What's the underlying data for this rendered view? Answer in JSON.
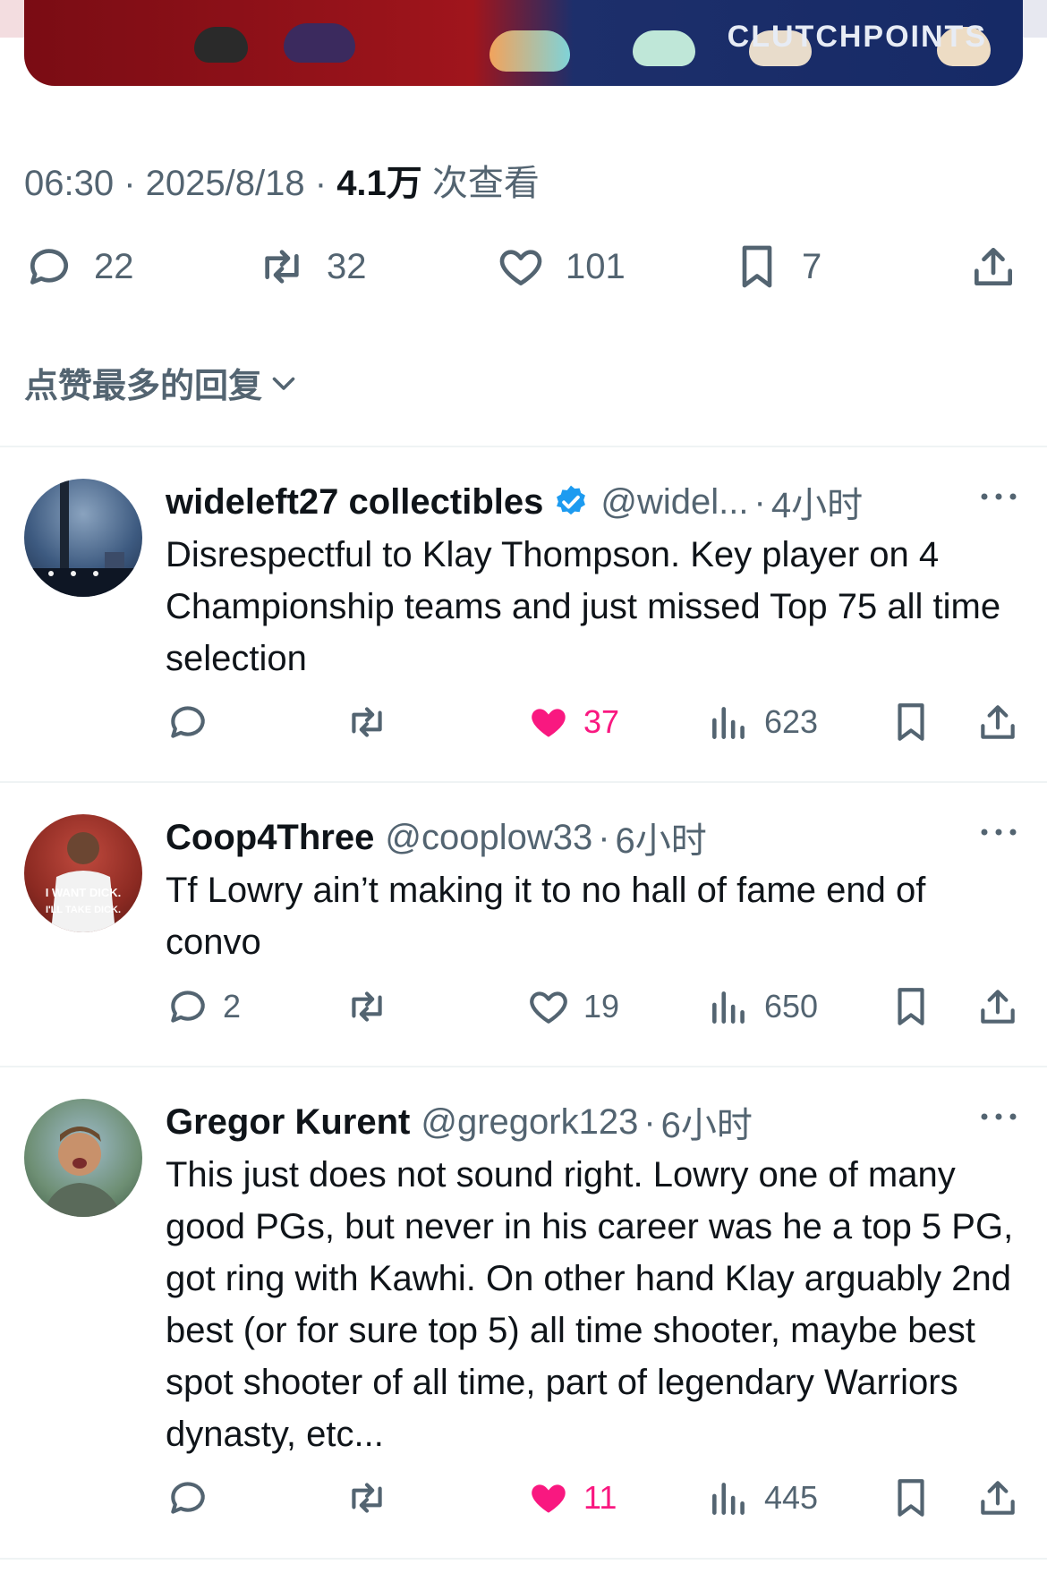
{
  "tweet": {
    "time": "06:30",
    "date": "2025/8/18",
    "views_count": "4.1万",
    "views_label": "次查看",
    "stats": {
      "replies": "22",
      "retweets": "32",
      "likes": "101",
      "bookmarks": "7"
    },
    "media_text": "CLUTCHPOINTS"
  },
  "sort_label": "点赞最多的回复",
  "replies": [
    {
      "name": "wideleft27 collectibles",
      "verified": true,
      "handle": "@widel...",
      "time": "4小时",
      "text": "Disrespectful to Klay Thompson. Key player on 4 Championship teams and just missed Top 75 all time selection",
      "reply_count": "",
      "likes": "37",
      "liked": true,
      "views": "623"
    },
    {
      "name": "Coop4Three",
      "verified": false,
      "handle": "@cooplow33",
      "time": "6小时",
      "text": "Tf Lowry ain’t making it to no hall of fame end of convo",
      "reply_count": "2",
      "likes": "19",
      "liked": false,
      "views": "650",
      "avatar_text": [
        "I WANT DICK.",
        "I'LL TAKE DICK."
      ]
    },
    {
      "name": "Gregor Kurent",
      "verified": false,
      "handle": "@gregork123",
      "time": "6小时",
      "text": "This just does not sound right. Lowry one of many good PGs, but never in his career was he a top 5 PG, got ring with Kawhi. On other hand Klay arguably 2nd best (or for sure top 5) all time shooter, maybe best spot shooter of all time, part of legendary Warriors dynasty, etc...",
      "reply_count": "",
      "likes": "11",
      "liked": true,
      "views": "445"
    }
  ],
  "colors": {
    "text": "#0f1419",
    "secondary": "#536471",
    "like": "#f91880",
    "verified": "#1d9bf0"
  }
}
